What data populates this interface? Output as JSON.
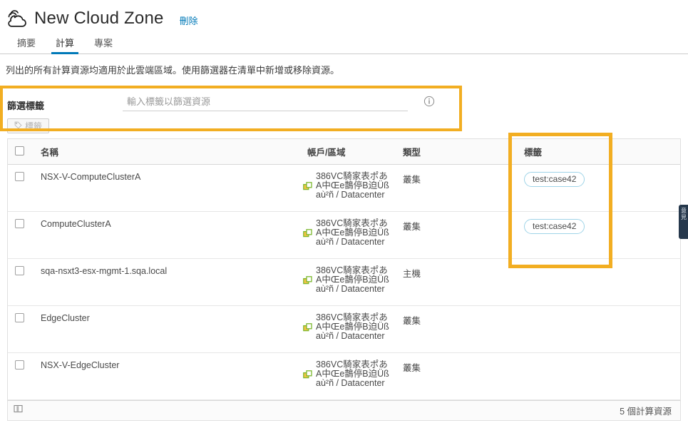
{
  "header": {
    "logo_icon": "cloud-icon",
    "title": "New Cloud Zone",
    "delete_label": "刪除"
  },
  "tabs": [
    {
      "label": "摘要",
      "active": false
    },
    {
      "label": "計算",
      "active": true
    },
    {
      "label": "專案",
      "active": false
    }
  ],
  "description": "列出的所有計算資源均適用於此雲端區域。使用篩選器在清單中新增或移除資源。",
  "filter": {
    "label": "篩選標籤",
    "placeholder": "輸入標籤以篩選資源",
    "value": "",
    "info_icon": "info-circle-icon",
    "tag_button_label": "標籤",
    "tag_button_icon": "tag-icon",
    "highlight_color": "#f2ae22"
  },
  "table": {
    "columns": [
      "名稱",
      "帳戶/區域",
      "類型",
      "標籤"
    ],
    "account_region_text": "386VC騎家表ポあA中Œe鵲停B迫Üßaù²ñ / Datacenter",
    "link_icon": "external-link-icon",
    "rows": [
      {
        "name": "NSX-V-ComputeClusterA",
        "account": "386VC騎家表ポあA中Œe鵲停B迫Üßaù²ñ / Datacenter",
        "type": "叢集",
        "tag": "test:case42"
      },
      {
        "name": "ComputeClusterA",
        "account": "386VC騎家表ポあA中Œe鵲停B迫Üßaù²ñ / Datacenter",
        "type": "叢集",
        "tag": "test:case42"
      },
      {
        "name": "sqa-nsxt3-esx-mgmt-1.sqa.local",
        "account": "386VC騎家表ポあA中Œe鵲停B迫Üßaù²ñ / Datacenter",
        "type": "主機",
        "tag": ""
      },
      {
        "name": "EdgeCluster",
        "account": "386VC騎家表ポあA中Œe鵲停B迫Üßaù²ñ / Datacenter",
        "type": "叢集",
        "tag": ""
      },
      {
        "name": "NSX-V-EdgeCluster",
        "account": "386VC騎家表ポあA中Œe鵲停B迫Üßaù²ñ / Datacenter",
        "type": "叢集",
        "tag": ""
      }
    ]
  },
  "footer": {
    "columns_icon": "column-picker-icon",
    "count_label": "5 個計算資源"
  },
  "edge_widget": {
    "label": "意見"
  },
  "colors": {
    "accent_blue": "#0079b8",
    "highlight_orange": "#f2ae22",
    "chip_border": "#9fd4e8",
    "link_icon_green": "#7cb82f"
  }
}
